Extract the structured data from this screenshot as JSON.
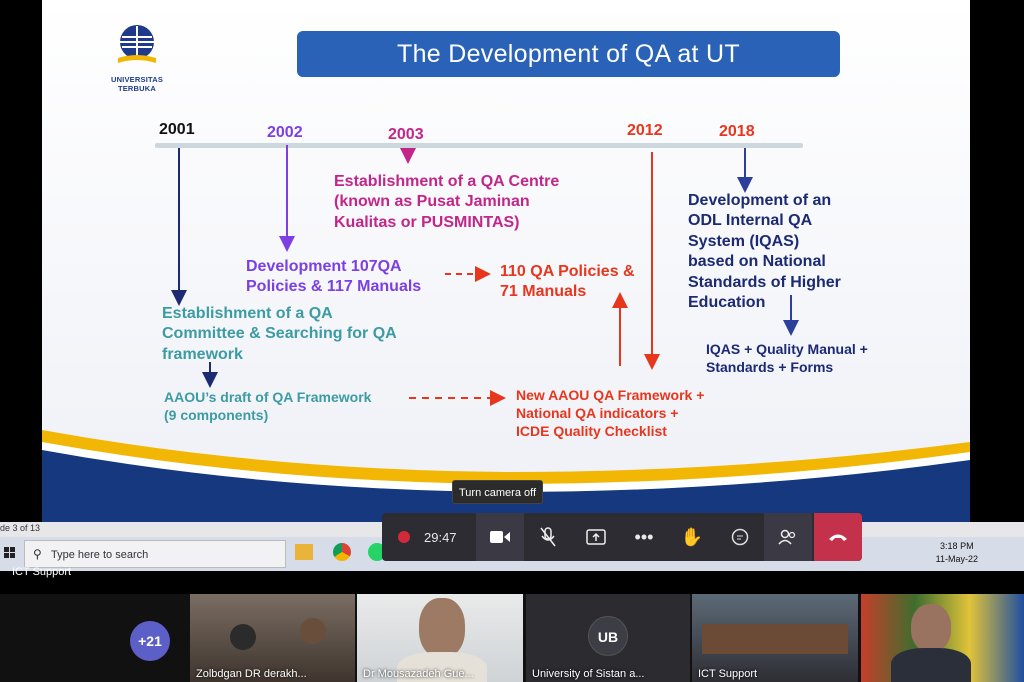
{
  "slide": {
    "title": "The Development of QA at UT",
    "logo_text": "UNIVERSITAS TERBUKA",
    "years": {
      "y2001": "2001",
      "y2002": "2002",
      "y2003": "2003",
      "y2012": "2012",
      "y2018": "2018"
    },
    "events": {
      "e2001_l1": "Establishment of a QA",
      "e2001_l2": "Committee & Searching for QA",
      "e2001_l3": "framework",
      "e2001_b1": "AAOU’s draft of QA Framework",
      "e2001_b2": "(9 components)",
      "e2002_l1": "Development  107QA",
      "e2002_l2": "Policies & 117 Manuals",
      "e2003_l1": "Establishment of a QA Centre",
      "e2003_l2": "(known as Pusat Jaminan",
      "e2003_l3": "Kualitas or PUSMINTAS)",
      "e2012_a1": "110 QA Policies &",
      "e2012_a2": "71 Manuals",
      "e2012_b1": "New AAOU QA Framework +",
      "e2012_b2": "National QA indicators +",
      "e2012_b3": "ICDE Quality Checklist",
      "e2018_l1": "Development of an",
      "e2018_l2": "ODL Internal QA",
      "e2018_l3": "System (IQAS)",
      "e2018_l4": "based on National",
      "e2018_l5": "Standards of Higher",
      "e2018_l6": "Education",
      "e2018_b1": "IQAS + Quality Manual +",
      "e2018_b2": "Standards + Forms"
    },
    "colors": {
      "black": "#111111",
      "purple": "#7b3fe4",
      "magenta": "#c2268a",
      "red": "#e8361d",
      "navy": "#1b2a73",
      "teal": "#3c9ba3",
      "blue_title": "#2a62b8"
    }
  },
  "meeting": {
    "tooltip": "Turn camera off",
    "timer": "29:47",
    "controls": [
      "record-icon",
      "camera-icon",
      "mic-off-icon",
      "share-icon",
      "more-icon",
      "raise-hand-icon",
      "chat-icon",
      "participants-icon",
      "hang-up-icon"
    ]
  },
  "host_screen": {
    "slide_indicator": "de 3 of 13",
    "search_placeholder": "Type here to search",
    "time": "3:18 PM",
    "date": "11-May-22",
    "presenter": "ICT Support"
  },
  "participants": {
    "overflow_count": "+21",
    "tiles": [
      {
        "name": "Zolbdgan  DR derakh..."
      },
      {
        "name": "Dr Mousazadeh  Gue..."
      },
      {
        "initials": "UB",
        "name": "University of Sistan a..."
      },
      {
        "name": "ICT Support"
      },
      {
        "name": ""
      }
    ]
  }
}
